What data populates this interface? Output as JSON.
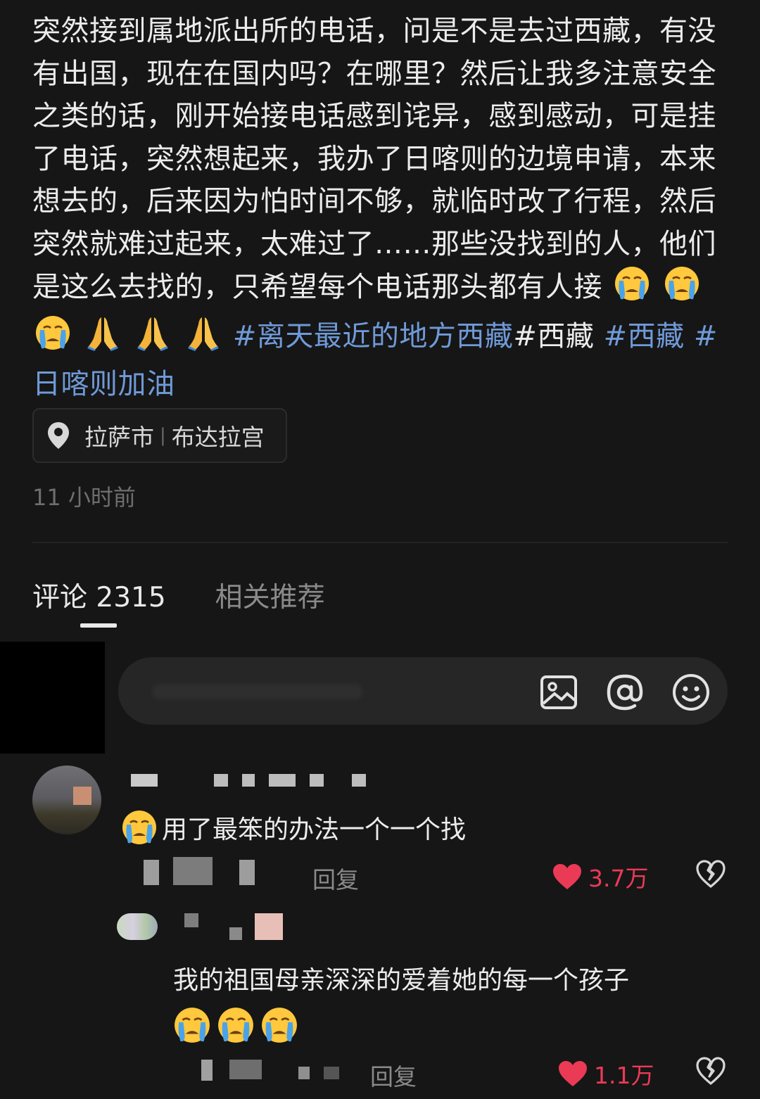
{
  "post": {
    "text": "突然接到属地派出所的电话，问是不是去过西藏，有没有出国，现在在国内吗？在哪里？然后让我多注意安全之类的话，刚开始接电话感到诧异，感到感动，可是挂了电话，突然想起来，我办了日喀则的边境申请，本来想去的，后来因为怕时间不够，就临时改了行程，然后突然就难过起来，太难过了……那些没找到的人，他们是这么去找的，只希望每个电话那头都有人接",
    "emojis": [
      "crying-face",
      "crying-face",
      "crying-face",
      "praying-hands",
      "praying-hands",
      "praying-hands"
    ],
    "hashtag_1": "#离天最近的地方西藏",
    "plain_tag": "#西藏",
    "hashtag_2": "#西藏",
    "hashtag_3": "#日喀则加油"
  },
  "location": {
    "city": "拉萨市",
    "separator": "|",
    "place": "布达拉宫",
    "icon": "location-pin-icon"
  },
  "timestamp": "11 小时前",
  "tabs": {
    "comments": "评论 2315",
    "related": "相关推荐"
  },
  "input": {
    "icons": [
      "image-icon",
      "at-icon",
      "emoji-icon"
    ]
  },
  "comments": [
    {
      "text": "用了最笨的办法一个一个找",
      "emoji": "crying-face",
      "reply_label": "回复",
      "likes": "3.7万"
    },
    {
      "text": "我的祖国母亲深深的爱着她的每一个孩子",
      "emojis": [
        "crying-face",
        "crying-face",
        "crying-face"
      ],
      "reply_label": "回复",
      "likes": "1.1万"
    }
  ],
  "colors": {
    "background": "#161616",
    "hashtag": "#6f9ad8",
    "like": "#eb3a56",
    "muted": "#8a8a8a"
  }
}
